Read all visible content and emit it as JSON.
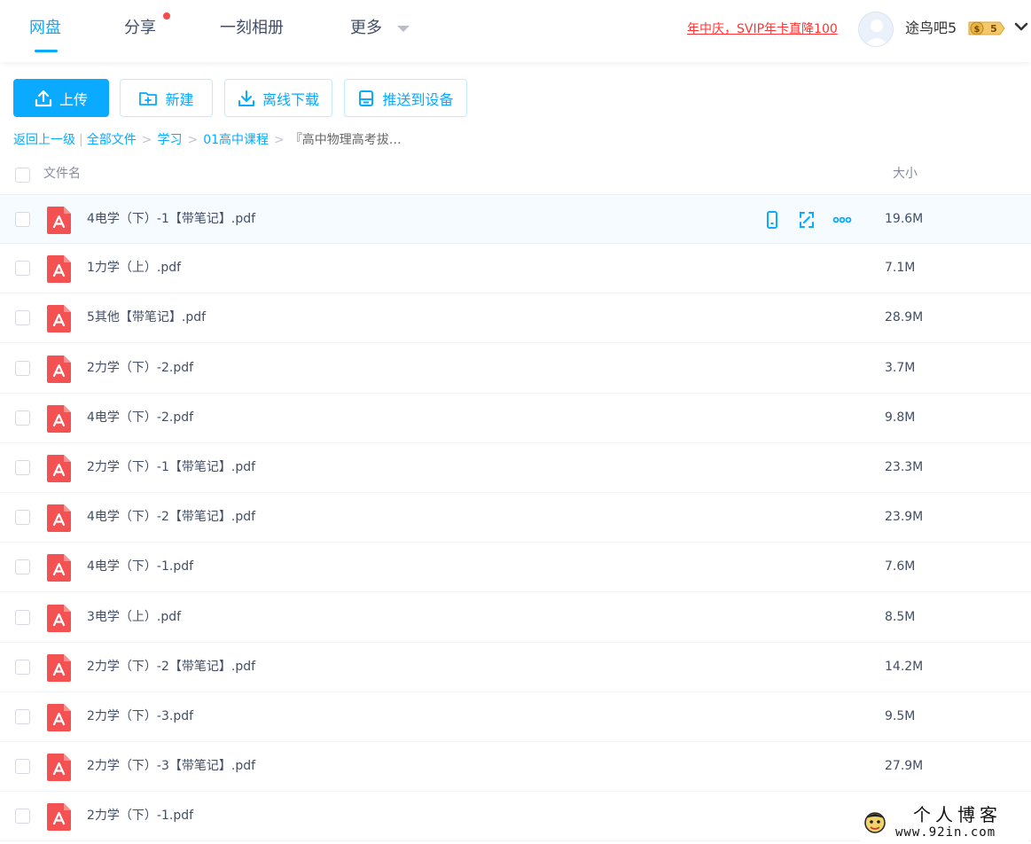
{
  "nav": {
    "tabs": [
      {
        "label": "网盘",
        "active": true
      },
      {
        "label": "分享",
        "has_dot": true
      },
      {
        "label": "一刻相册"
      },
      {
        "label": "更多"
      }
    ],
    "promo_text": "年中庆，SVIP年卡直降100",
    "username": "途鸟吧5",
    "vip_level": "5"
  },
  "toolbar": {
    "upload_label": "上传",
    "new_label": "新建",
    "offline_download_label": "离线下载",
    "push_to_device_label": "推送到设备"
  },
  "breadcrumb": {
    "back": "返回上一级",
    "items": [
      "全部文件",
      "学习",
      "01高中课程"
    ],
    "current": "『高中物理高考拔…"
  },
  "list_header": {
    "name": "文件名",
    "size": "大小"
  },
  "files": [
    {
      "name": "4电学（下）-1【带笔记】.pdf",
      "size": "19.6M",
      "hovered": true
    },
    {
      "name": "1力学（上）.pdf",
      "size": "7.1M"
    },
    {
      "name": "5其他【带笔记】.pdf",
      "size": "28.9M"
    },
    {
      "name": "2力学（下）-2.pdf",
      "size": "3.7M"
    },
    {
      "name": "4电学（下）-2.pdf",
      "size": "9.8M"
    },
    {
      "name": "2力学（下）-1【带笔记】.pdf",
      "size": "23.3M"
    },
    {
      "name": "4电学（下）-2【带笔记】.pdf",
      "size": "23.9M"
    },
    {
      "name": "4电学（下）-1.pdf",
      "size": "7.6M"
    },
    {
      "name": "3电学（上）.pdf",
      "size": "8.5M"
    },
    {
      "name": "2力学（下）-2【带笔记】.pdf",
      "size": "14.2M"
    },
    {
      "name": "2力学（下）-3.pdf",
      "size": "9.5M"
    },
    {
      "name": "2力学（下）-3【带笔记】.pdf",
      "size": "27.9M"
    },
    {
      "name": "2力学（下）-1.pdf",
      "size": ""
    }
  ],
  "watermark": {
    "title": "个人博客",
    "url": "www.92in.com"
  },
  "colors": {
    "accent": "#09aaff",
    "promo": "#ff3333",
    "pdf_icon": "#f45252",
    "text": "#424e67"
  }
}
